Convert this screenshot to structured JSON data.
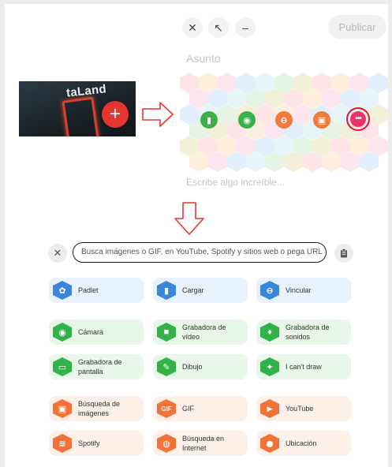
{
  "toolbar": {
    "close_glyph": "✕",
    "expand_glyph": "↖",
    "minimize_glyph": "–",
    "publish_label": "Publicar"
  },
  "post": {
    "subject_placeholder": "Asunto",
    "body_placeholder": "Escribe algo increíble..."
  },
  "thumbnail": {
    "sign_text": "taLand",
    "add_glyph": "+"
  },
  "attachment_icons": [
    {
      "name": "upload-icon",
      "glyph": "▮",
      "color": "#3fae4d"
    },
    {
      "name": "camera-icon",
      "glyph": "◉",
      "color": "#35b34a"
    },
    {
      "name": "link-icon",
      "glyph": "⊖",
      "color": "#f07b3f"
    },
    {
      "name": "image-search-icon",
      "glyph": "▣",
      "color": "#f07b3f"
    },
    {
      "name": "more-icon",
      "glyph": "•••",
      "color": "#e9336a"
    }
  ],
  "search": {
    "close_glyph": "✕",
    "placeholder": "Busca imágenes o GIF, en YouTube, Spotify y sitios web o pega URL"
  },
  "options": [
    {
      "label": "Padlet",
      "glyph": "✿",
      "group": "blue"
    },
    {
      "label": "Cargar",
      "glyph": "▮",
      "group": "blue"
    },
    {
      "label": "Vincular",
      "glyph": "⊖",
      "group": "blue"
    },
    {
      "label": "Cámara",
      "glyph": "◉",
      "group": "green"
    },
    {
      "label": "Grabadora de vídeo",
      "glyph": "■",
      "group": "green"
    },
    {
      "label": "Grabadora de sonidos",
      "glyph": "♦",
      "group": "green"
    },
    {
      "label": "Grabadora de pantalla",
      "glyph": "▭",
      "group": "green"
    },
    {
      "label": "Dibujo",
      "glyph": "✎",
      "group": "green"
    },
    {
      "label": "I can't draw",
      "glyph": "✦",
      "group": "green"
    },
    {
      "label": "Búsqueda de imágenes",
      "glyph": "▣",
      "group": "orange"
    },
    {
      "label": "GIF",
      "glyph": "GIF",
      "group": "orange"
    },
    {
      "label": "YouTube",
      "glyph": "▶",
      "group": "orange"
    },
    {
      "label": "Spotify",
      "glyph": "≋",
      "group": "orange"
    },
    {
      "label": "Búsqueda en Internet",
      "glyph": "◍",
      "group": "orange"
    },
    {
      "label": "Ubicación",
      "glyph": "⬤",
      "group": "orange"
    }
  ],
  "colors": {
    "accent_red": "#e5352f",
    "blue": "#3a86d8",
    "green": "#34b24a",
    "orange": "#f2733a"
  }
}
